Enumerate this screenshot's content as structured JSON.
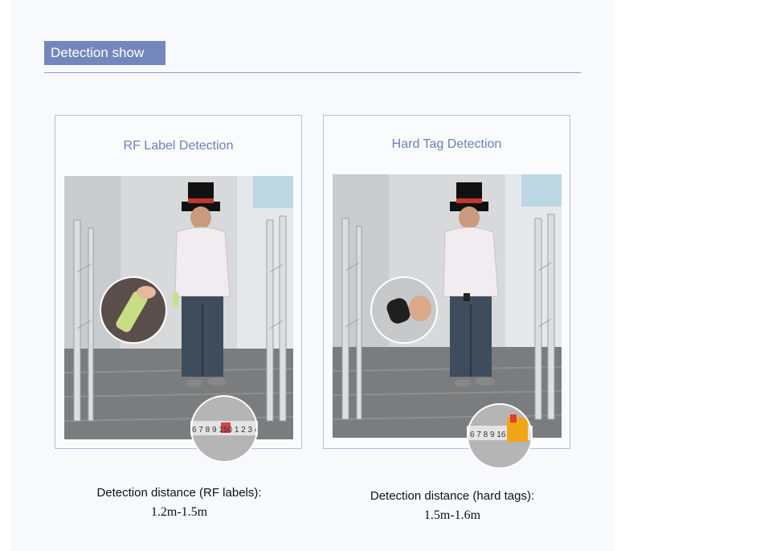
{
  "header": {
    "title": "Detection show"
  },
  "cards": [
    {
      "title": "RF Label Detection",
      "caption_label": "Detection distance (RF labels):",
      "caption_value": "1.2m-1.5m",
      "ruler_text": "6 7 8 9 150 1 2 3 4",
      "ruler_highlight": "150",
      "item_icon": "bottle-icon"
    },
    {
      "title": "Hard Tag Detection",
      "caption_label": "Detection distance (hard tags):",
      "caption_value": "1.5m-1.6m",
      "ruler_text": "6 7 8 9 16",
      "ruler_highlight": "16",
      "item_icon": "hard-tag-icon"
    }
  ]
}
